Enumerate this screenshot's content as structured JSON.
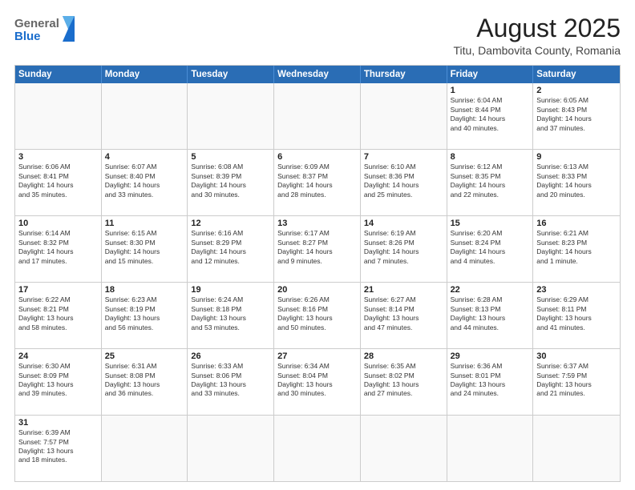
{
  "logo": {
    "text_general": "General",
    "text_blue": "Blue"
  },
  "header": {
    "title": "August 2025",
    "subtitle": "Titu, Dambovita County, Romania"
  },
  "days_of_week": [
    "Sunday",
    "Monday",
    "Tuesday",
    "Wednesday",
    "Thursday",
    "Friday",
    "Saturday"
  ],
  "weeks": [
    [
      {
        "day": "",
        "info": ""
      },
      {
        "day": "",
        "info": ""
      },
      {
        "day": "",
        "info": ""
      },
      {
        "day": "",
        "info": ""
      },
      {
        "day": "",
        "info": ""
      },
      {
        "day": "1",
        "info": "Sunrise: 6:04 AM\nSunset: 8:44 PM\nDaylight: 14 hours\nand 40 minutes."
      },
      {
        "day": "2",
        "info": "Sunrise: 6:05 AM\nSunset: 8:43 PM\nDaylight: 14 hours\nand 37 minutes."
      }
    ],
    [
      {
        "day": "3",
        "info": "Sunrise: 6:06 AM\nSunset: 8:41 PM\nDaylight: 14 hours\nand 35 minutes."
      },
      {
        "day": "4",
        "info": "Sunrise: 6:07 AM\nSunset: 8:40 PM\nDaylight: 14 hours\nand 33 minutes."
      },
      {
        "day": "5",
        "info": "Sunrise: 6:08 AM\nSunset: 8:39 PM\nDaylight: 14 hours\nand 30 minutes."
      },
      {
        "day": "6",
        "info": "Sunrise: 6:09 AM\nSunset: 8:37 PM\nDaylight: 14 hours\nand 28 minutes."
      },
      {
        "day": "7",
        "info": "Sunrise: 6:10 AM\nSunset: 8:36 PM\nDaylight: 14 hours\nand 25 minutes."
      },
      {
        "day": "8",
        "info": "Sunrise: 6:12 AM\nSunset: 8:35 PM\nDaylight: 14 hours\nand 22 minutes."
      },
      {
        "day": "9",
        "info": "Sunrise: 6:13 AM\nSunset: 8:33 PM\nDaylight: 14 hours\nand 20 minutes."
      }
    ],
    [
      {
        "day": "10",
        "info": "Sunrise: 6:14 AM\nSunset: 8:32 PM\nDaylight: 14 hours\nand 17 minutes."
      },
      {
        "day": "11",
        "info": "Sunrise: 6:15 AM\nSunset: 8:30 PM\nDaylight: 14 hours\nand 15 minutes."
      },
      {
        "day": "12",
        "info": "Sunrise: 6:16 AM\nSunset: 8:29 PM\nDaylight: 14 hours\nand 12 minutes."
      },
      {
        "day": "13",
        "info": "Sunrise: 6:17 AM\nSunset: 8:27 PM\nDaylight: 14 hours\nand 9 minutes."
      },
      {
        "day": "14",
        "info": "Sunrise: 6:19 AM\nSunset: 8:26 PM\nDaylight: 14 hours\nand 7 minutes."
      },
      {
        "day": "15",
        "info": "Sunrise: 6:20 AM\nSunset: 8:24 PM\nDaylight: 14 hours\nand 4 minutes."
      },
      {
        "day": "16",
        "info": "Sunrise: 6:21 AM\nSunset: 8:23 PM\nDaylight: 14 hours\nand 1 minute."
      }
    ],
    [
      {
        "day": "17",
        "info": "Sunrise: 6:22 AM\nSunset: 8:21 PM\nDaylight: 13 hours\nand 58 minutes."
      },
      {
        "day": "18",
        "info": "Sunrise: 6:23 AM\nSunset: 8:19 PM\nDaylight: 13 hours\nand 56 minutes."
      },
      {
        "day": "19",
        "info": "Sunrise: 6:24 AM\nSunset: 8:18 PM\nDaylight: 13 hours\nand 53 minutes."
      },
      {
        "day": "20",
        "info": "Sunrise: 6:26 AM\nSunset: 8:16 PM\nDaylight: 13 hours\nand 50 minutes."
      },
      {
        "day": "21",
        "info": "Sunrise: 6:27 AM\nSunset: 8:14 PM\nDaylight: 13 hours\nand 47 minutes."
      },
      {
        "day": "22",
        "info": "Sunrise: 6:28 AM\nSunset: 8:13 PM\nDaylight: 13 hours\nand 44 minutes."
      },
      {
        "day": "23",
        "info": "Sunrise: 6:29 AM\nSunset: 8:11 PM\nDaylight: 13 hours\nand 41 minutes."
      }
    ],
    [
      {
        "day": "24",
        "info": "Sunrise: 6:30 AM\nSunset: 8:09 PM\nDaylight: 13 hours\nand 39 minutes."
      },
      {
        "day": "25",
        "info": "Sunrise: 6:31 AM\nSunset: 8:08 PM\nDaylight: 13 hours\nand 36 minutes."
      },
      {
        "day": "26",
        "info": "Sunrise: 6:33 AM\nSunset: 8:06 PM\nDaylight: 13 hours\nand 33 minutes."
      },
      {
        "day": "27",
        "info": "Sunrise: 6:34 AM\nSunset: 8:04 PM\nDaylight: 13 hours\nand 30 minutes."
      },
      {
        "day": "28",
        "info": "Sunrise: 6:35 AM\nSunset: 8:02 PM\nDaylight: 13 hours\nand 27 minutes."
      },
      {
        "day": "29",
        "info": "Sunrise: 6:36 AM\nSunset: 8:01 PM\nDaylight: 13 hours\nand 24 minutes."
      },
      {
        "day": "30",
        "info": "Sunrise: 6:37 AM\nSunset: 7:59 PM\nDaylight: 13 hours\nand 21 minutes."
      }
    ],
    [
      {
        "day": "31",
        "info": "Sunrise: 6:39 AM\nSunset: 7:57 PM\nDaylight: 13 hours\nand 18 minutes."
      },
      {
        "day": "",
        "info": ""
      },
      {
        "day": "",
        "info": ""
      },
      {
        "day": "",
        "info": ""
      },
      {
        "day": "",
        "info": ""
      },
      {
        "day": "",
        "info": ""
      },
      {
        "day": "",
        "info": ""
      }
    ]
  ]
}
